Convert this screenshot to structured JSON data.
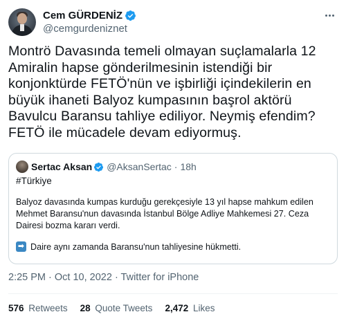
{
  "author": {
    "display_name": "Cem GÜRDENİZ",
    "handle": "@cemgurdeniznet",
    "verified_icon": "verified-badge-icon",
    "verified_color": "#1d9bf0"
  },
  "tweet": {
    "text": "Montrö Davasında temeli olmayan  suçlamalarla 12 Amiralin hapse gönderilmesinin istendiği bir konjonktürde FETÖ'nün ve işbirliği içindekilerin en büyük ihaneti Balyoz kumpasının başrol aktörü Bavulcu Baransu tahliye ediliyor. Neymiş efendim? FETÖ ile mücadele devam ediyormuş."
  },
  "quote": {
    "display_name": "Sertac Aksan",
    "handle": "@AksanSertac",
    "separator": "·",
    "age": "18h",
    "hashtag": "#Türkiye",
    "body": "Balyoz davasında kumpas kurduğu gerekçesiyle 13 yıl hapse mahkum edilen Mehmet Baransu'nun davasında İstanbul Bölge Adliye Mahkemesi 27. Ceza Dairesi bozma kararı verdi.",
    "arrow_icon": "right-arrow-emoji-icon",
    "arrow_glyph": "➡",
    "second_line": "Daire aynı zamanda Baransu'nun tahliyesine hükmetti."
  },
  "meta": {
    "timestamp": "2:25 PM · Oct 10, 2022 · Twitter for iPhone"
  },
  "stats": {
    "retweets_count": "576",
    "retweets_label": "Retweets",
    "quotes_count": "28",
    "quotes_label": "Quote Tweets",
    "likes_count": "2,472",
    "likes_label": "Likes"
  }
}
